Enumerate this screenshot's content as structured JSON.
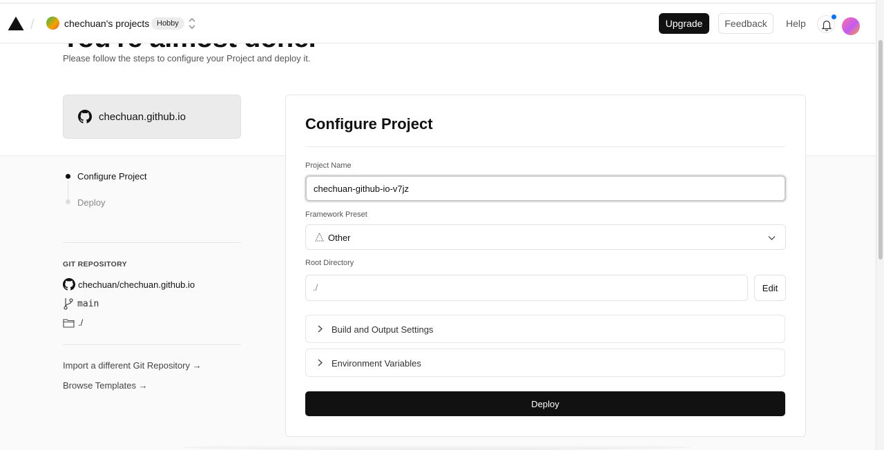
{
  "header": {
    "team_name": "chechuan's projects",
    "plan_badge": "Hobby",
    "upgrade_label": "Upgrade",
    "feedback_label": "Feedback",
    "help_label": "Help"
  },
  "hero": {
    "title": "You're almost done.",
    "subtitle": "Please follow the steps to configure your Project and deploy it."
  },
  "repo_card": {
    "name": "chechuan.github.io",
    "icon": "github-icon"
  },
  "steps": [
    {
      "label": "Configure Project",
      "active": true
    },
    {
      "label": "Deploy",
      "active": false
    }
  ],
  "git": {
    "heading": "GIT REPOSITORY",
    "repo": "chechuan/chechuan.github.io",
    "branch": "main",
    "directory": "./"
  },
  "links": {
    "import_repo": "Import a different Git Repository →",
    "browse_templates": "Browse Templates →"
  },
  "config": {
    "title": "Configure Project",
    "project_name_label": "Project Name",
    "project_name_value": "chechuan-github-io-v7jz",
    "framework_label": "Framework Preset",
    "framework_value": "Other",
    "root_dir_label": "Root Directory",
    "root_dir_value": "./",
    "edit_label": "Edit",
    "build_settings_label": "Build and Output Settings",
    "env_vars_label": "Environment Variables",
    "deploy_label": "Deploy"
  },
  "colors": {
    "primary_button": "#111111",
    "notification_dot": "#0a72ef"
  }
}
